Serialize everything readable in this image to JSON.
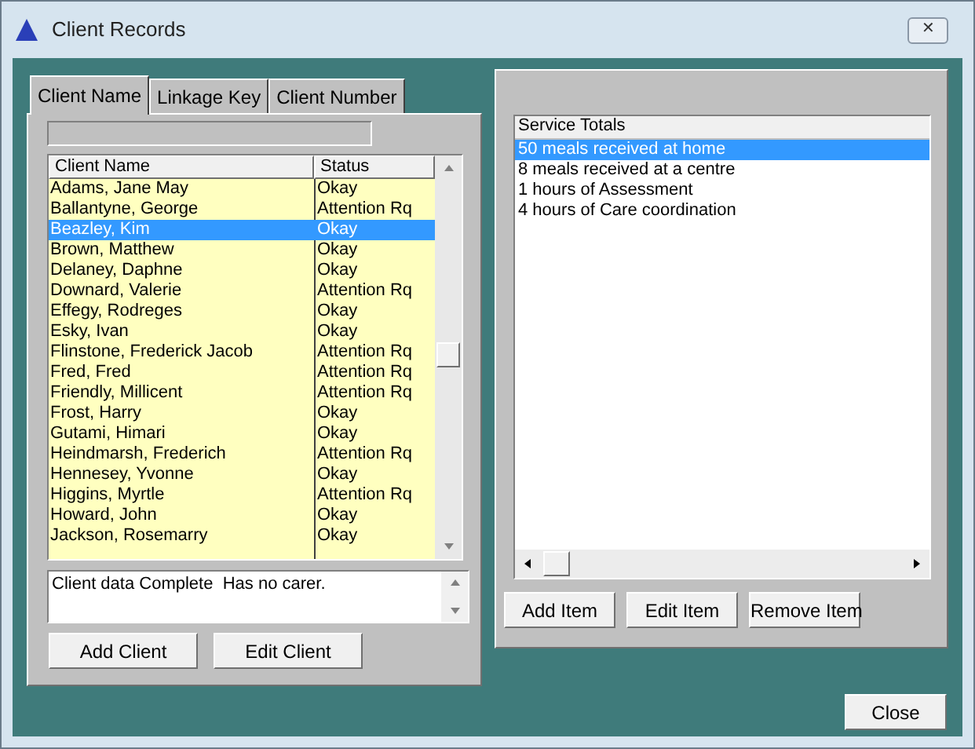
{
  "window": {
    "title": "Client Records",
    "close_button": "✕"
  },
  "tabs": [
    {
      "label": "Client Name",
      "selected": true
    },
    {
      "label": "Linkage Key",
      "selected": false
    },
    {
      "label": "Client Number",
      "selected": false
    }
  ],
  "client_list": {
    "columns": [
      "Client Name",
      "Status"
    ],
    "rows": [
      {
        "name": "Adams, Jane May",
        "status": "Okay",
        "selected": false
      },
      {
        "name": "Ballantyne, George",
        "status": "Attention Rq",
        "selected": false
      },
      {
        "name": "Beazley, Kim",
        "status": "Okay",
        "selected": true
      },
      {
        "name": "Brown, Matthew",
        "status": "Okay",
        "selected": false
      },
      {
        "name": "Delaney, Daphne",
        "status": "Okay",
        "selected": false
      },
      {
        "name": "Downard, Valerie",
        "status": "Attention Rq",
        "selected": false
      },
      {
        "name": "Effegy, Rodreges",
        "status": "Okay",
        "selected": false
      },
      {
        "name": "Esky, Ivan",
        "status": "Okay",
        "selected": false
      },
      {
        "name": "Flinstone, Frederick Jacob",
        "status": "Attention Rq",
        "selected": false
      },
      {
        "name": "Fred, Fred",
        "status": "Attention Rq",
        "selected": false
      },
      {
        "name": "Friendly, Millicent",
        "status": "Attention Rq",
        "selected": false
      },
      {
        "name": "Frost, Harry",
        "status": "Okay",
        "selected": false
      },
      {
        "name": "Gutami, Himari",
        "status": "Okay",
        "selected": false
      },
      {
        "name": "Heindmarsh, Frederich",
        "status": "Attention Rq",
        "selected": false
      },
      {
        "name": "Hennesey, Yvonne",
        "status": "Okay",
        "selected": false
      },
      {
        "name": "Higgins, Myrtle",
        "status": "Attention Rq",
        "selected": false
      },
      {
        "name": "Howard, John",
        "status": "Okay",
        "selected": false
      },
      {
        "name": "Jackson, Rosemarry",
        "status": "Okay",
        "selected": false
      }
    ]
  },
  "client_notes": "Client data Complete  Has no carer.",
  "client_buttons": [
    "Add Client",
    "Edit Client"
  ],
  "service_totals": {
    "header": "Service Totals",
    "items": [
      {
        "label": "50 meals received at home",
        "selected": true
      },
      {
        "label": "8 meals received at a centre",
        "selected": false
      },
      {
        "label": "1 hours of Assessment",
        "selected": false
      },
      {
        "label": "4 hours of Care coordination",
        "selected": false
      }
    ]
  },
  "service_buttons": [
    "Add Item",
    "Edit Item",
    "Remove Item"
  ],
  "footer_button": "Close"
}
